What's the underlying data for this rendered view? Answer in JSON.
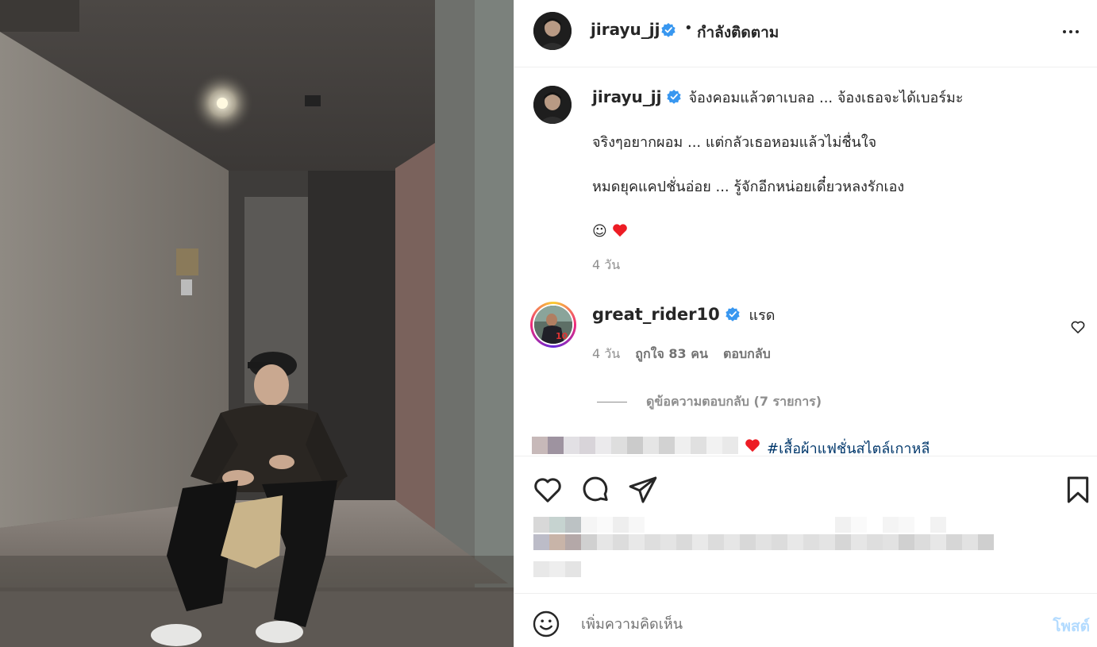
{
  "post": {
    "author": "jirayu_jj",
    "follow_status": "กำลังติดตาม",
    "header_separator": "•",
    "more_icon": "more-horizontal-icon"
  },
  "caption": {
    "username": "jirayu_jj",
    "line1": "จ้องคอมแล้วตาเบลอ ... จ้องเธอจะได้เบอร์มะ",
    "line2": "จริงๆอยากผอม ... แต่กลัวเธอหอมแล้วไม่ชื่นใจ",
    "line3": "หมดยุคแคปชั่นอ่อย ... รู้จักอีกหน่อยเดี๋ยวหลงรักเอง",
    "line4": "☺",
    "time": "4 วัน"
  },
  "comments": [
    {
      "username": "great_rider10",
      "text": "แรด",
      "time": "4 วัน",
      "likes": "ถูกใจ 83 คน",
      "reply_label": "ตอบกลับ",
      "view_replies": "ดูข้อความตอบกลับ (7 รายการ)"
    }
  ],
  "partial_comment": {
    "hashtag": "#เสื้อผ้าแฟชั่นสไตล์เกาหลี"
  },
  "actions": {
    "like_icon": "heart-icon",
    "comment_icon": "comment-icon",
    "share_icon": "share-icon",
    "save_icon": "bookmark-icon"
  },
  "add_comment": {
    "placeholder": "เพิ่มความคิดเห็น",
    "post_label": "โพสต์"
  },
  "colors": {
    "verified": "#3897f0",
    "heart": "#ed4956",
    "post_button_disabled": "#b3dbff",
    "secondary_text": "#8e8e8e"
  }
}
